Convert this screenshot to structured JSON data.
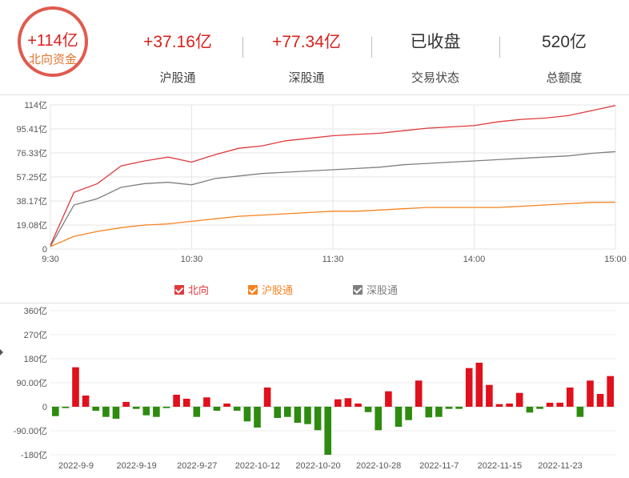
{
  "header": {
    "total": {
      "value": "+114亿",
      "label": "北向资金"
    },
    "stats": [
      {
        "value": "+37.16亿",
        "label": "沪股通",
        "color": "#d9201c"
      },
      {
        "value": "+77.34亿",
        "label": "深股通",
        "color": "#d9201c"
      },
      {
        "value": "已收盘",
        "label": "交易状态",
        "color": "#333333"
      },
      {
        "value": "520亿",
        "label": "总额度",
        "color": "#333333"
      }
    ]
  },
  "chart_data": [
    {
      "type": "line",
      "title": "",
      "x_ticks": [
        "9:30",
        "10:30",
        "11:30",
        "14:00",
        "15:00"
      ],
      "y_ticks": [
        "114亿",
        "95.41亿",
        "76.33亿",
        "57.25亿",
        "38.17亿",
        "19.08亿",
        "0"
      ],
      "ylim": [
        0,
        114.5
      ],
      "grid": true,
      "legend_position": "bottom-center",
      "x": [
        "9:30",
        "9:40",
        "9:50",
        "10:00",
        "10:10",
        "10:20",
        "10:30",
        "10:40",
        "10:50",
        "11:00",
        "11:10",
        "11:20",
        "11:30",
        "13:10",
        "13:20",
        "13:30",
        "13:40",
        "13:50",
        "14:00",
        "14:10",
        "14:20",
        "14:30",
        "14:40",
        "14:50",
        "15:00"
      ],
      "series": [
        {
          "name": "北向",
          "color": "#e0393c",
          "values": [
            3,
            45,
            52,
            66,
            70,
            73,
            69,
            75,
            80,
            82,
            86,
            88,
            90,
            91,
            92,
            94,
            96,
            97,
            98,
            101,
            103,
            104,
            106,
            110,
            114
          ]
        },
        {
          "name": "沪股通",
          "color": "#f5821f",
          "values": [
            2,
            10,
            14,
            17,
            19,
            20,
            22,
            24,
            26,
            27,
            28,
            29,
            30,
            30,
            31,
            32,
            33,
            33,
            33,
            33,
            34,
            35,
            36,
            37,
            37.16
          ]
        },
        {
          "name": "深股通",
          "color": "#7f7f7f",
          "values": [
            2,
            35,
            40,
            49,
            52,
            53,
            51,
            56,
            58,
            60,
            61,
            62,
            63,
            64,
            65,
            67,
            68,
            69,
            70,
            71,
            72,
            73,
            74,
            76,
            77.34
          ]
        }
      ]
    },
    {
      "type": "bar",
      "title": "",
      "y_ticks": [
        "360亿",
        "270亿",
        "180亿",
        "90.00亿",
        "0",
        "-90.00亿",
        "-180亿"
      ],
      "ylim": [
        -180,
        360
      ],
      "x_ticks": [
        "2022-9-9",
        "2022-9-19",
        "2022-9-27",
        "2022-10-12",
        "2022-10-20",
        "2022-10-28",
        "2022-11-7",
        "2022-11-15",
        "2022-11-23"
      ],
      "positive_color": "#e0101c",
      "negative_color": "#2e8b10",
      "values": [
        -35,
        -5,
        148,
        42,
        -15,
        -38,
        -45,
        18,
        -8,
        -32,
        -38,
        -5,
        45,
        30,
        -38,
        35,
        -15,
        12,
        -15,
        -55,
        -78,
        72,
        -42,
        -38,
        -60,
        -65,
        -88,
        -180,
        28,
        32,
        12,
        -20,
        -88,
        58,
        -75,
        -50,
        98,
        -40,
        -38,
        -8,
        -8,
        145,
        165,
        82,
        10,
        12,
        52,
        -22,
        -8,
        15,
        15,
        72,
        -38,
        98,
        48,
        115
      ]
    }
  ]
}
